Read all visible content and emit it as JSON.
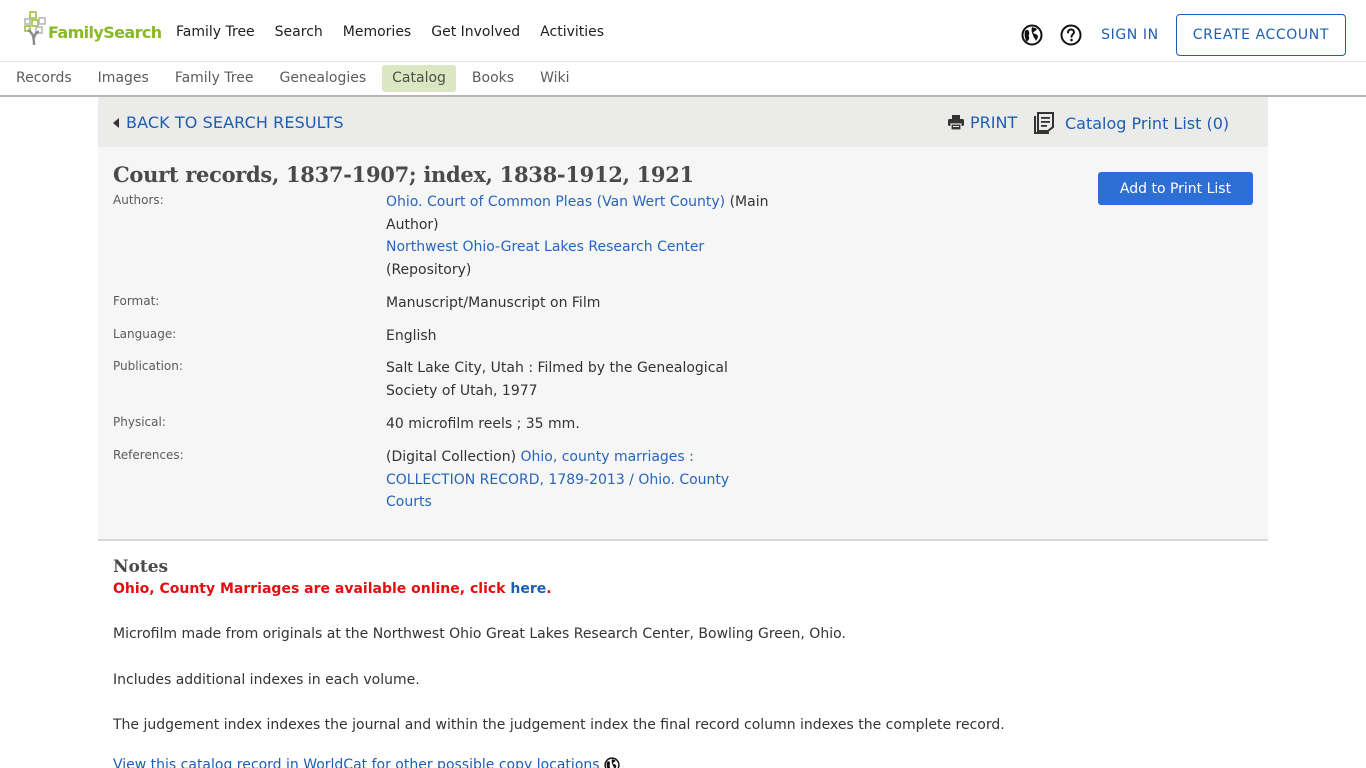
{
  "header": {
    "logo_text": "FamilySearch",
    "brand_color": "#87b928",
    "nav": [
      "Family Tree",
      "Search",
      "Memories",
      "Get Involved",
      "Activities"
    ],
    "language_icon": "globe-icon",
    "help_icon": "question-circle-icon",
    "sign_in": "SIGN IN",
    "create_account": "CREATE ACCOUNT"
  },
  "sub_nav": {
    "items": [
      "Records",
      "Images",
      "Family Tree",
      "Genealogies",
      "Catalog",
      "Books",
      "Wiki"
    ],
    "active": "Catalog"
  },
  "toolbar": {
    "back": "BACK TO SEARCH RESULTS",
    "print": "PRINT",
    "print_list": "Catalog Print List (0)"
  },
  "record": {
    "title": "Court records, 1837-1907; index, 1838-1912, 1921",
    "add_to_print_list": "Add to Print List",
    "fields": {
      "authors": {
        "label": "Authors:",
        "author1_link": "Ohio. Court of Common Pleas (Van Wert County)",
        "author1_role": " (Main Author)",
        "author2_link": "Northwest Ohio-Great Lakes Research Center",
        "author2_role": " (Repository)"
      },
      "format": {
        "label": "Format:",
        "value": "Manuscript/Manuscript on Film"
      },
      "language": {
        "label": "Language:",
        "value": "English"
      },
      "publication": {
        "label": "Publication:",
        "value": "Salt Lake City, Utah : Filmed by the Genealogical Society of Utah, 1977"
      },
      "physical": {
        "label": "Physical:",
        "value": "40 microfilm reels ; 35 mm."
      },
      "references": {
        "label": "References:",
        "prefix": "(Digital Collection) ",
        "link": "Ohio, county marriages : COLLECTION RECORD, 1789-2013 / Ohio. County Courts"
      }
    }
  },
  "notes": {
    "heading": "Notes",
    "alert_text": "Ohio, County Marriages are available online, click ",
    "alert_link": "here",
    "alert_end": ".",
    "alert_color": "#e30e0e",
    "paragraphs": [
      "Microfilm made from originals at the Northwest Ohio Great Lakes Research Center, Bowling Green, Ohio.",
      "Includes additional indexes in each volume.",
      "The judgement index indexes the journal and within the judgement index the final record column indexes the complete record."
    ],
    "worldcat_link": "View this catalog record in WorldCat for other possible copy locations"
  }
}
